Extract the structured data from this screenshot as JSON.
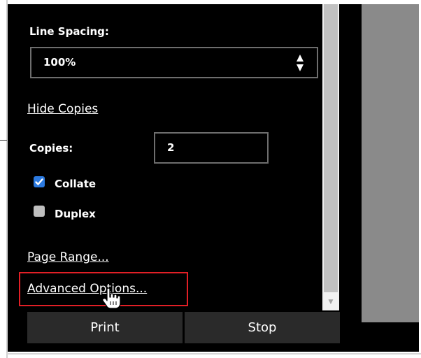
{
  "line_spacing": {
    "label": "Line Spacing:",
    "value": "100%"
  },
  "hide_copies_link": "Hide Copies",
  "copies": {
    "label": "Copies:",
    "value": "2"
  },
  "collate": {
    "label": "Collate",
    "checked": true
  },
  "duplex": {
    "label": "Duplex",
    "checked": false
  },
  "page_range_link": "Page Range...",
  "advanced_options_link": "Advanced Options...",
  "buttons": {
    "print": "Print",
    "stop": "Stop"
  },
  "colors": {
    "highlight": "#e21f26",
    "checkbox_accent": "#2c7ae0",
    "panel": "#000000"
  },
  "icons": [
    "select-arrows-icon",
    "checkmark-icon",
    "hand-pointer-cursor-icon",
    "scroll-down-arrow-icon"
  ]
}
